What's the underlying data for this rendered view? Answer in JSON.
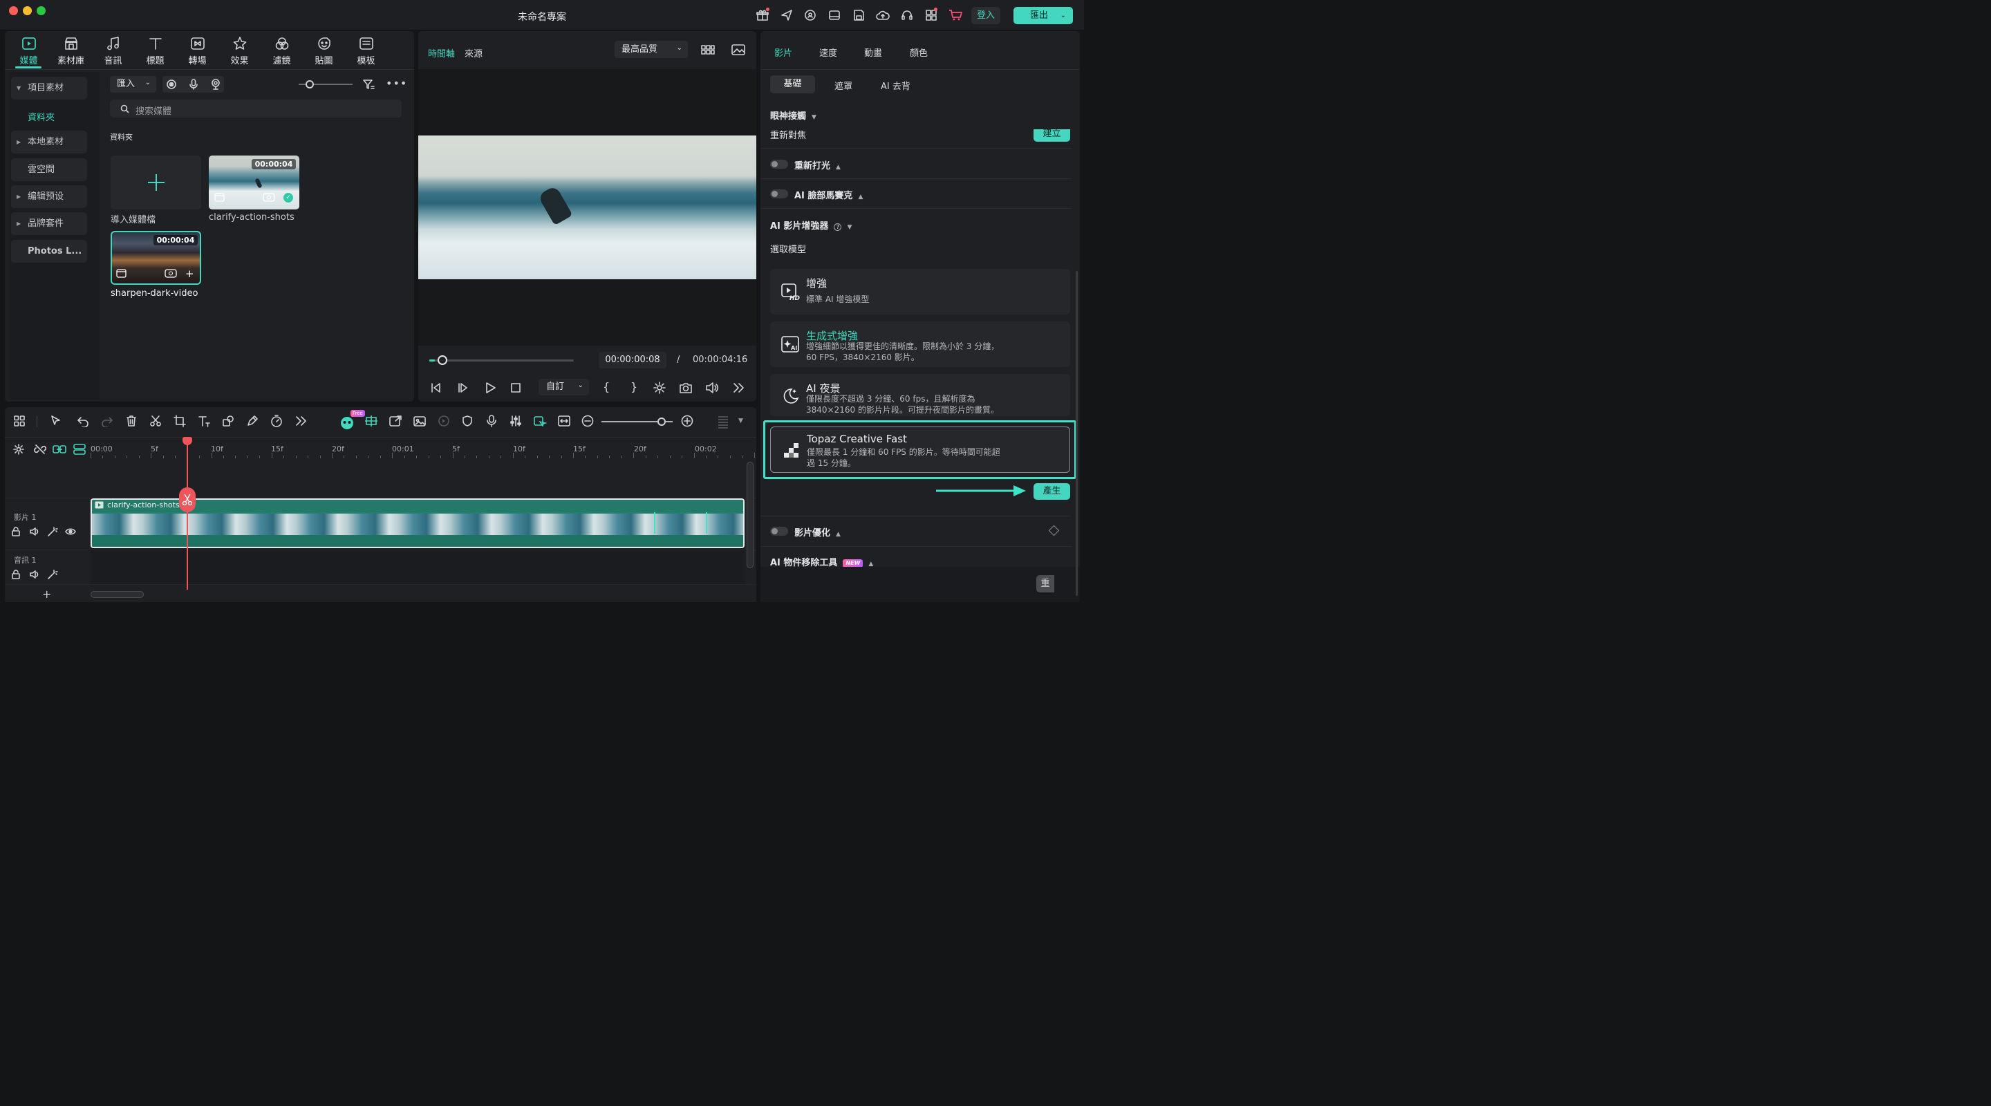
{
  "window": {
    "title": "未命名專案",
    "login": "登入",
    "export": "匯出"
  },
  "toolbar": {
    "items": [
      "媒體",
      "素材庫",
      "音訊",
      "標題",
      "轉場",
      "效果",
      "濾鏡",
      "貼圖",
      "模板"
    ]
  },
  "sidebar": {
    "items": [
      "項目素材",
      "資料夾",
      "本地素材",
      "雲空間",
      "编辑预设",
      "品牌套件",
      "Photos L..."
    ]
  },
  "media": {
    "import_label": "匯入",
    "search_placeholder": "搜索媒體",
    "folder_label": "資料夾",
    "import_tile_label": "導入媒體檔",
    "clips": [
      {
        "name": "clarify-action-shots",
        "duration": "00:00:04"
      },
      {
        "name": "sharpen-dark-video",
        "duration": "00:00:04"
      }
    ]
  },
  "preview": {
    "tab_timeline": "時間軸",
    "tab_source": "來源",
    "quality": "最高品質",
    "current_time": "00:00:00:08",
    "separator": "/",
    "total_time": "00:00:04:16",
    "ratio_label": "自訂",
    "progress_fraction": 0.04
  },
  "properties": {
    "tabs": [
      "影片",
      "速度",
      "動畫",
      "顏色"
    ],
    "subtabs": [
      "基礎",
      "遮罩",
      "AI 去背"
    ],
    "eye_contact": "眼神接觸",
    "refocus": "重新對焦",
    "create_button": "建立",
    "relight": "重新打光",
    "face_mosaic": "AI 臉部馬賽克",
    "enhancer": "AI 影片增強器",
    "select_model": "選取模型",
    "models": [
      {
        "title": "增強",
        "desc": "標準 AI 增強模型"
      },
      {
        "title": "生成式增強",
        "desc1": "增強細節以獲得更佳的清晰度。限制為小於 3 分鐘，",
        "desc2": "60 FPS，3840×2160 影片。"
      },
      {
        "title": "AI 夜景",
        "desc1": "僅限長度不超過 3 分鐘、60 fps，且解析度為",
        "desc2": "3840×2160 的影片片段。可提升夜間影片的畫質。"
      },
      {
        "title": "Topaz Creative Fast",
        "desc1": "僅限最長 1 分鐘和 60 FPS 的影片。等待時間可能超",
        "desc2": "過 15 分鐘。"
      }
    ],
    "generate_button": "產生",
    "video_optimize": "影片優化",
    "object_removal": "AI 物件移除工具",
    "new_badge": "NEW",
    "reset_button": "重"
  },
  "timeline": {
    "ticks": [
      "00:00",
      "5f",
      "10f",
      "15f",
      "20f",
      "00:01",
      "5f",
      "10f",
      "15f",
      "20f",
      "00:02"
    ],
    "free_badge": "Free",
    "track_video": "影片 1",
    "track_audio": "音訊 1",
    "clip_label": "clarify-action-shots"
  },
  "colors": {
    "accent": "#45d6bf",
    "playhead": "#f0555b",
    "highlight": "#3fe3c8"
  }
}
